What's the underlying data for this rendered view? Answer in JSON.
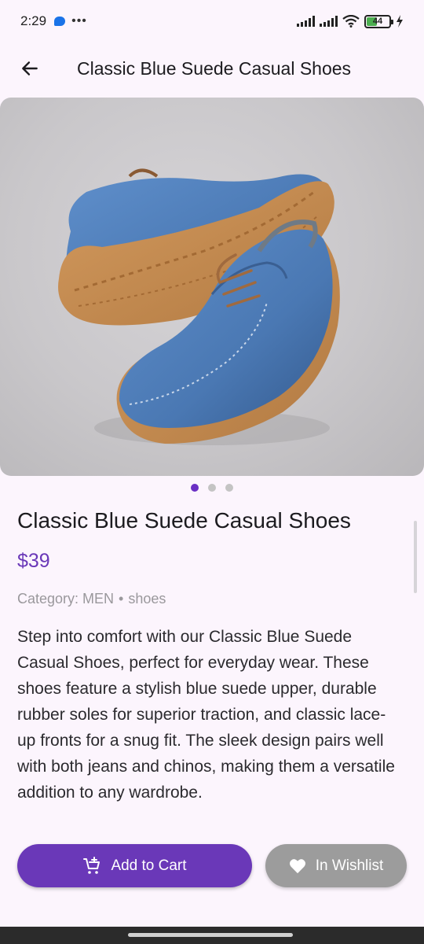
{
  "status_bar": {
    "time": "2:29",
    "more": "•••",
    "battery": "44",
    "battery_level": 0.44
  },
  "app_bar": {
    "title": "Classic Blue Suede Casual Shoes",
    "back_icon": "arrow-left-icon"
  },
  "gallery": {
    "image_count": 3,
    "active_index": 0
  },
  "product": {
    "title": "Classic Blue Suede Casual Shoes",
    "price": "$39",
    "category": "Category: MEN",
    "separator": "•",
    "subcategory": "shoes",
    "description": "Step into comfort with our Classic Blue Suede Casual Shoes, perfect for everyday wear. These shoes feature a stylish blue suede upper, durable rubber soles for superior traction, and classic lace-up fronts for a snug fit. The sleek design pairs well with both jeans and chinos, making them a versatile addition to any wardrobe."
  },
  "actions": {
    "add_to_cart": {
      "label": "Add to Cart",
      "icon": "add-to-cart-icon"
    },
    "wishlist": {
      "label": "In Wishlist",
      "icon": "heart-icon"
    }
  },
  "colors": {
    "primary": "#6a38b8",
    "background": "#fcf5fd",
    "wishlist_button": "#9c9c9c"
  }
}
